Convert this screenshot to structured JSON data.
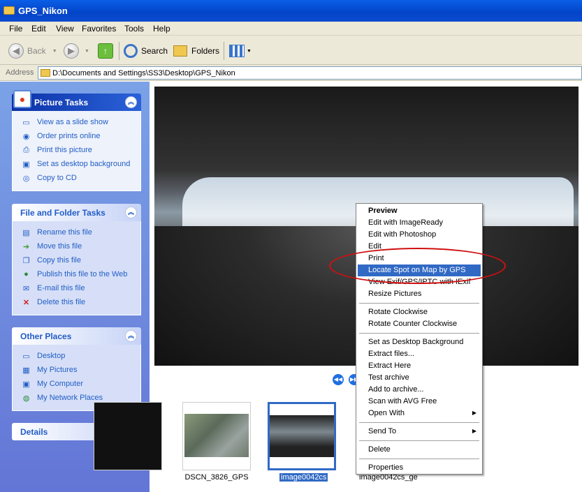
{
  "window": {
    "title": "GPS_Nikon"
  },
  "menu": [
    "File",
    "Edit",
    "View",
    "Favorites",
    "Tools",
    "Help"
  ],
  "toolbar": {
    "back": "Back",
    "search": "Search",
    "folders": "Folders"
  },
  "address": {
    "label": "Address",
    "path": "D:\\Documents and Settings\\SS3\\Desktop\\GPS_Nikon"
  },
  "sidebar": {
    "picture_tasks": {
      "title": "Picture Tasks",
      "items": [
        {
          "label": "View as a slide show",
          "icon": "slideshow-icon"
        },
        {
          "label": "Order prints online",
          "icon": "order-prints-icon"
        },
        {
          "label": "Print this picture",
          "icon": "printer-icon"
        },
        {
          "label": "Set as desktop background",
          "icon": "desktop-background-icon"
        },
        {
          "label": "Copy to CD",
          "icon": "cd-icon"
        }
      ]
    },
    "file_tasks": {
      "title": "File and Folder Tasks",
      "items": [
        {
          "label": "Rename this file",
          "icon": "rename-icon"
        },
        {
          "label": "Move this file",
          "icon": "move-icon"
        },
        {
          "label": "Copy this file",
          "icon": "copy-icon"
        },
        {
          "label": "Publish this file to the Web",
          "icon": "globe-icon"
        },
        {
          "label": "E-mail this file",
          "icon": "email-icon"
        },
        {
          "label": "Delete this file",
          "icon": "delete-icon"
        }
      ]
    },
    "other_places": {
      "title": "Other Places",
      "items": [
        {
          "label": "Desktop",
          "icon": "desktop-icon"
        },
        {
          "label": "My Pictures",
          "icon": "my-pictures-icon"
        },
        {
          "label": "My Computer",
          "icon": "my-computer-icon"
        },
        {
          "label": "My Network Places",
          "icon": "network-icon"
        }
      ]
    },
    "details": {
      "title": "Details"
    }
  },
  "thumbnails": [
    {
      "caption": "DSCN_3826_GPS"
    },
    {
      "caption": "image0042cs"
    },
    {
      "caption": "image0042cs_ge"
    }
  ],
  "context_menu": [
    {
      "label": "Preview"
    },
    {
      "label": "Edit with ImageReady"
    },
    {
      "label": "Edit with Photoshop"
    },
    {
      "label": "Edit"
    },
    {
      "label": "Print"
    },
    {
      "label": "Locate Spot on Map by GPS"
    },
    {
      "label": "View Exif/GPS/IPTC with IExif"
    },
    {
      "label": "Resize Pictures"
    },
    {
      "label": "Rotate Clockwise"
    },
    {
      "label": "Rotate Counter Clockwise"
    },
    {
      "label": "Set as Desktop Background"
    },
    {
      "label": "Extract files..."
    },
    {
      "label": "Extract Here"
    },
    {
      "label": "Test archive"
    },
    {
      "label": "Add to archive..."
    },
    {
      "label": "Scan with AVG Free"
    },
    {
      "label": "Open With"
    },
    {
      "label": "Send To"
    },
    {
      "label": "Delete"
    },
    {
      "label": "Properties"
    }
  ],
  "colors": {
    "title_bar": "#0a5ee6",
    "sidebar": "#7ba2e7",
    "highlight": "#316ac5",
    "annotation": "#d01010"
  }
}
